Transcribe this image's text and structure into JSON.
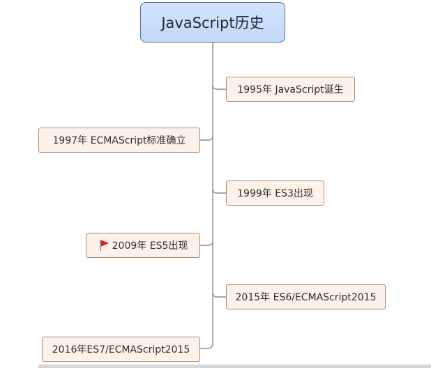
{
  "root": {
    "label": "JavaScript历史"
  },
  "nodes": [
    {
      "label": "1995年 JavaScript诞生"
    },
    {
      "label": "1997年 ECMAScript标准确立"
    },
    {
      "label": "1999年 ES3出现"
    },
    {
      "label": "2009年 ES5出现",
      "icon": "red-flag-icon"
    },
    {
      "label": "2015年 ES6/ECMAScript2015"
    },
    {
      "label": "2016年ES7/ECMAScript2015"
    }
  ],
  "colors": {
    "root_fill": "#c8dcf9",
    "root_border": "#5a6f94",
    "node_fill": "#fdf2e9",
    "node_border": "#a38a74",
    "connector": "#8a8a8a",
    "flag": "#e8141c"
  }
}
